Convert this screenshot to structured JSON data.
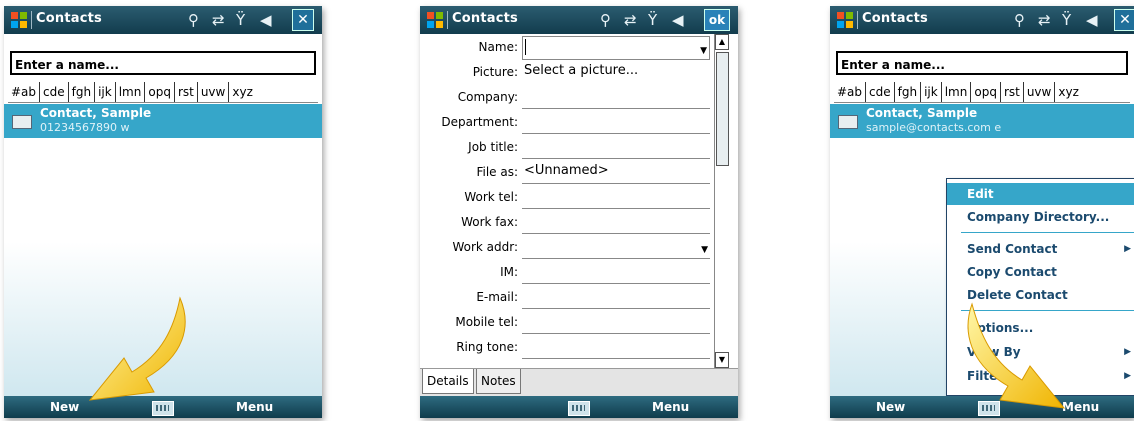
{
  "colors": {
    "title_bar": "#123c4d",
    "highlight": "#36a6c9",
    "arrow": "#f5c400"
  },
  "screen1": {
    "title": "Contacts",
    "close_label": "✕",
    "search_placeholder": "Enter a name...",
    "letters": [
      "#ab",
      "cde",
      "fgh",
      "ijk",
      "lmn",
      "opq",
      "rst",
      "uvw",
      "xyz"
    ],
    "contact": {
      "name": "Contact, Sample",
      "detail": "01234567890   w"
    },
    "softkeys": {
      "left": "New",
      "right": "Menu"
    }
  },
  "screen2": {
    "title": "Contacts",
    "ok_label": "ok",
    "fields": [
      {
        "label": "Name:",
        "value": ""
      },
      {
        "label": "Picture:",
        "value": "Select a picture..."
      },
      {
        "label": "Company:",
        "value": ""
      },
      {
        "label": "Department:",
        "value": ""
      },
      {
        "label": "Job title:",
        "value": ""
      },
      {
        "label": "File as:",
        "value": "<Unnamed>"
      },
      {
        "label": "Work tel:",
        "value": ""
      },
      {
        "label": "Work fax:",
        "value": ""
      },
      {
        "label": "Work addr:",
        "value": ""
      },
      {
        "label": "IM:",
        "value": ""
      },
      {
        "label": "E-mail:",
        "value": ""
      },
      {
        "label": "Mobile tel:",
        "value": ""
      },
      {
        "label": "Ring tone:",
        "value": ""
      }
    ],
    "tabs": [
      "Details",
      "Notes"
    ],
    "softkeys": {
      "right": "Menu"
    }
  },
  "screen3": {
    "title": "Contacts",
    "close_label": "✕",
    "search_placeholder": "Enter a name...",
    "letters": [
      "#ab",
      "cde",
      "fgh",
      "ijk",
      "lmn",
      "opq",
      "rst",
      "uvw",
      "xyz"
    ],
    "contact": {
      "name": "Contact, Sample",
      "detail": "sample@contacts.com   e"
    },
    "menu": [
      "Edit",
      "Company Directory...",
      "Send Contact",
      "Copy Contact",
      "Delete Contact",
      "Options...",
      "View By",
      "Filter"
    ],
    "softkeys": {
      "left": "New",
      "right": "Menu"
    }
  }
}
